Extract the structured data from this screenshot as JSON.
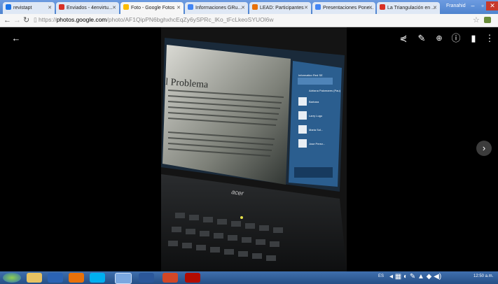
{
  "browser": {
    "tabs": [
      {
        "label": "revistapt",
        "active": false,
        "favicon_color": "#1a73e8"
      },
      {
        "label": "Enviados - 4envirtu...",
        "active": false,
        "favicon_color": "#d93025"
      },
      {
        "label": "Foto - Google Fotos",
        "active": true,
        "favicon_color": "#fbbc04"
      },
      {
        "label": "Informaciones GRu...",
        "active": false,
        "favicon_color": "#4285f4"
      },
      {
        "label": "LEAD: Participantes",
        "active": false,
        "favicon_color": "#e8710a"
      },
      {
        "label": "Presentaciones Pone...",
        "active": false,
        "favicon_color": "#4285f4"
      },
      {
        "label": "La Triangulación en ...",
        "active": false,
        "favicon_color": "#d93025"
      }
    ],
    "user_name": "Franahid",
    "url_scheme": "https://",
    "url_host": "photos.google.com",
    "url_path": "/photo/AF1QipPN6bghxhcEqZy6ySPRc_lKo_tFcLkeoSYUOl6w"
  },
  "viewer": {
    "photo_text": {
      "heading": "l Problema",
      "panel_title": "Informativo Red SE",
      "panel_items": [
        "Adriana Palomares (Pau)",
        "Barbara",
        "Larry Lugo",
        "Maria Sol...",
        "Jose Perez..."
      ],
      "laptop_brand": "acer"
    }
  },
  "taskbar": {
    "lang": "ES",
    "time": "12:50 a.m."
  },
  "colors": {
    "accent": "#5b8fd6",
    "taskbar": "#264f86"
  }
}
